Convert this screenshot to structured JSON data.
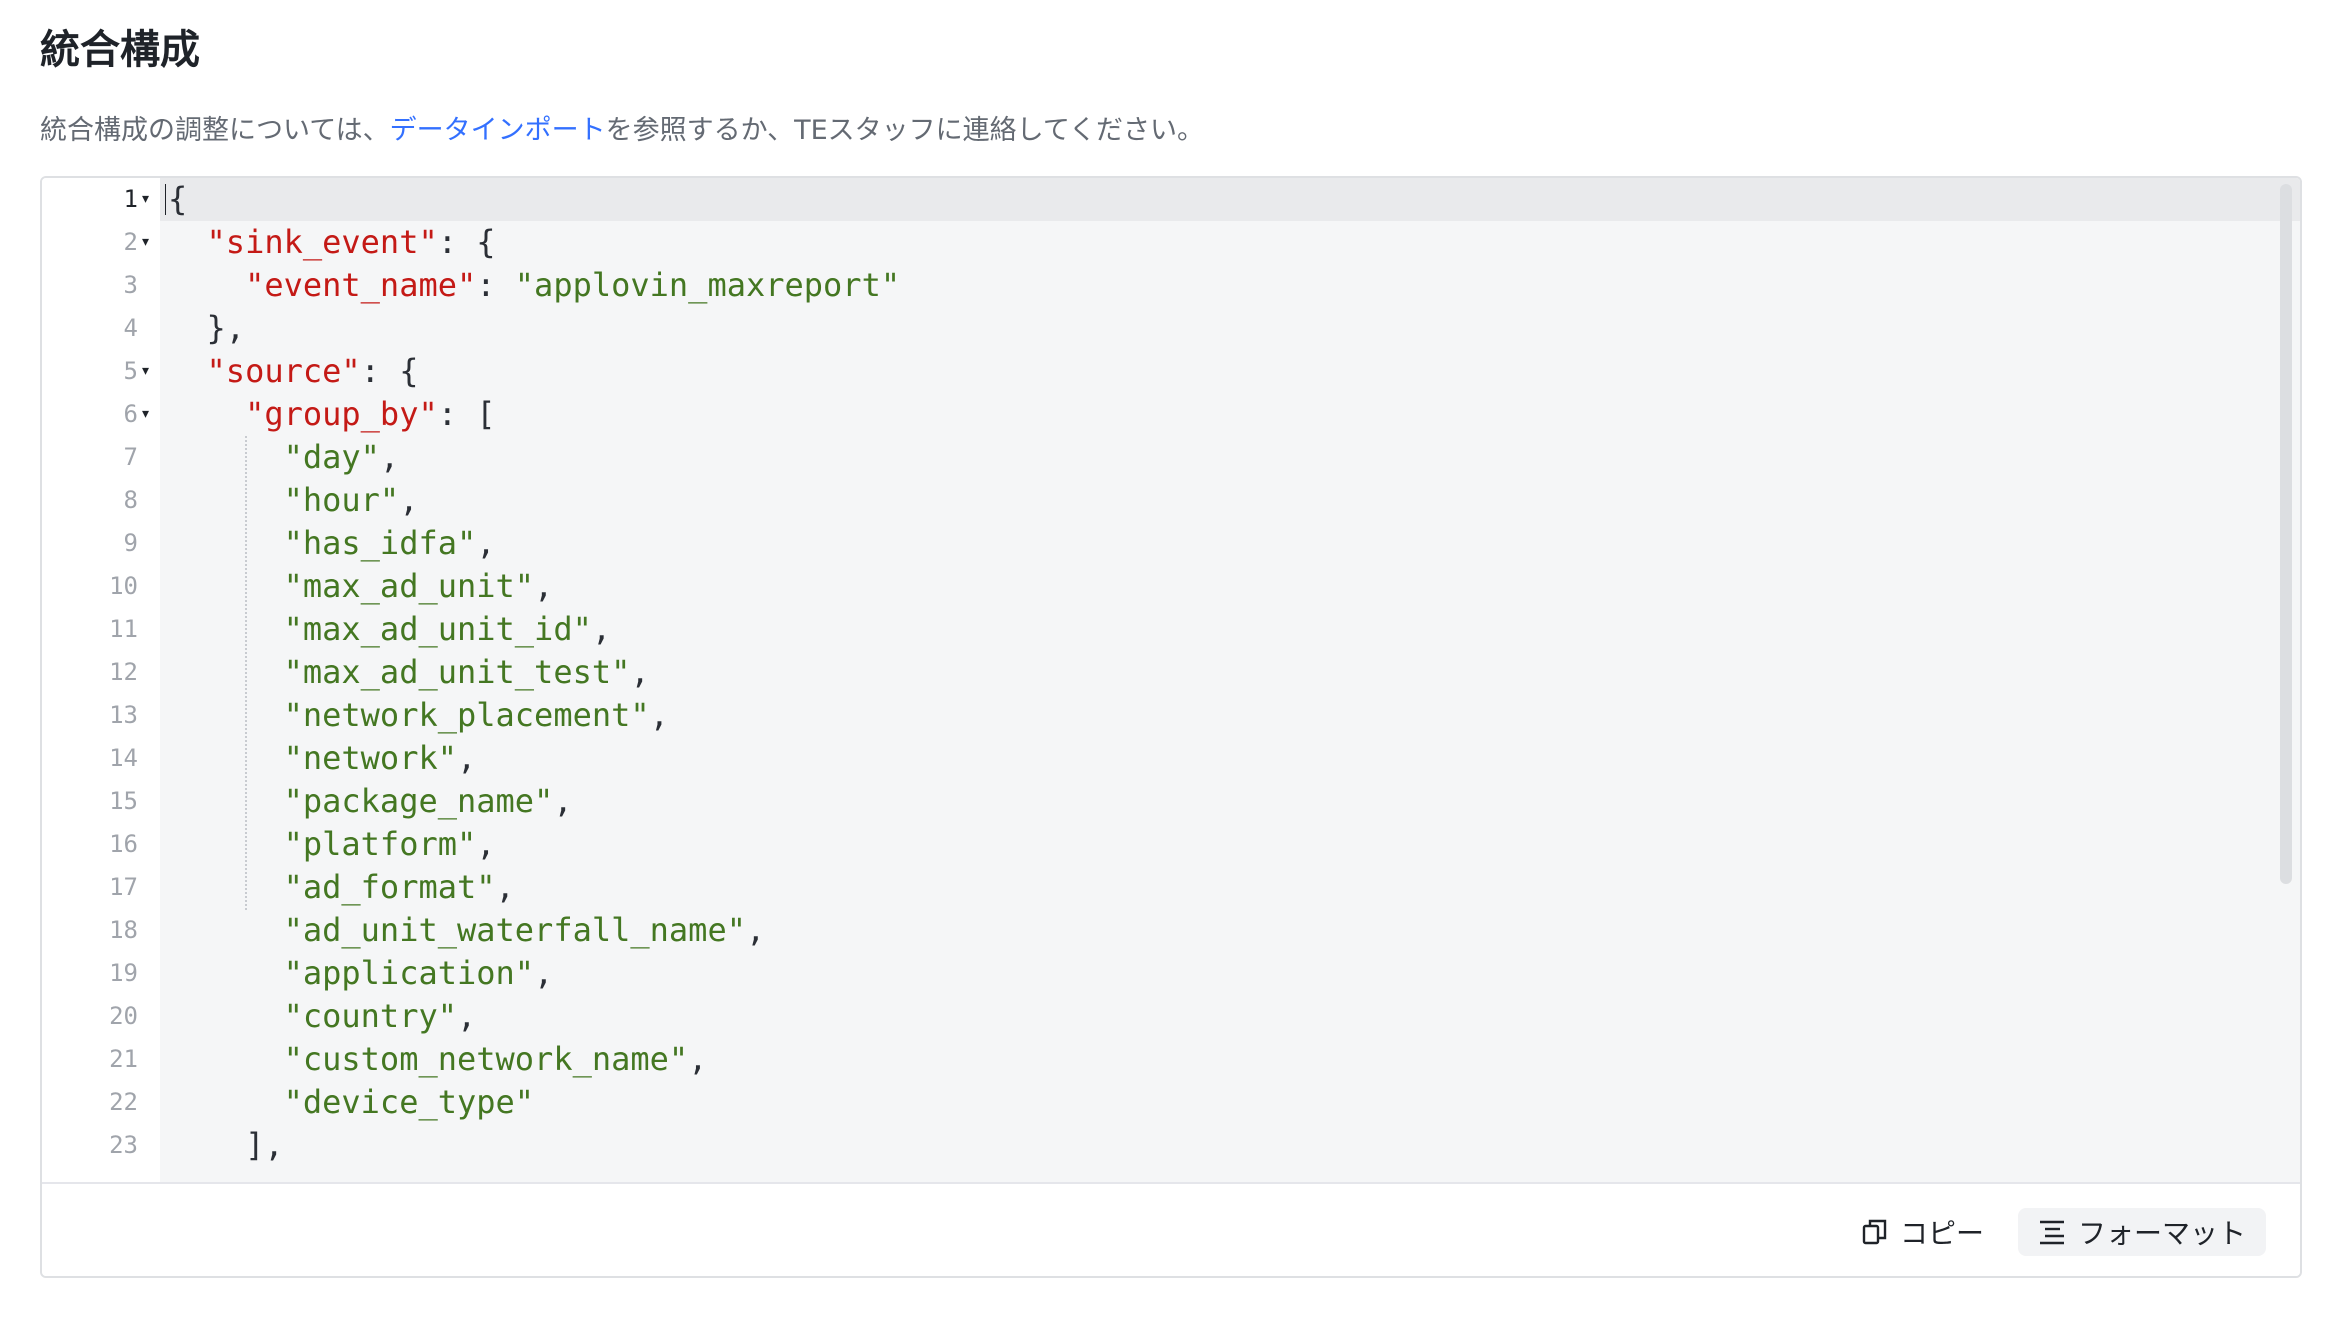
{
  "header": {
    "title": "統合構成",
    "desc_before": "統合構成の調整については、",
    "desc_link": "データインポート",
    "desc_after": "を参照するか、TEスタッフに連絡してください。"
  },
  "editor": {
    "lines": [
      {
        "n": "1",
        "fold": true,
        "indent": 0,
        "tokens": [
          [
            "pun",
            "{"
          ]
        ]
      },
      {
        "n": "2",
        "fold": true,
        "indent": 1,
        "tokens": [
          [
            "key",
            "\"sink_event\""
          ],
          [
            "pun",
            ": {"
          ]
        ]
      },
      {
        "n": "3",
        "fold": false,
        "indent": 2,
        "tokens": [
          [
            "key",
            "\"event_name\""
          ],
          [
            "pun",
            ": "
          ],
          [
            "str",
            "\"applovin_maxreport\""
          ]
        ]
      },
      {
        "n": "4",
        "fold": false,
        "indent": 1,
        "tokens": [
          [
            "pun",
            "},"
          ]
        ]
      },
      {
        "n": "5",
        "fold": true,
        "indent": 1,
        "tokens": [
          [
            "key",
            "\"source\""
          ],
          [
            "pun",
            ": {"
          ]
        ]
      },
      {
        "n": "6",
        "fold": true,
        "indent": 2,
        "tokens": [
          [
            "key",
            "\"group_by\""
          ],
          [
            "pun",
            ": ["
          ]
        ]
      },
      {
        "n": "7",
        "fold": false,
        "indent": 3,
        "tokens": [
          [
            "str",
            "\"day\""
          ],
          [
            "pun",
            ","
          ]
        ]
      },
      {
        "n": "8",
        "fold": false,
        "indent": 3,
        "tokens": [
          [
            "str",
            "\"hour\""
          ],
          [
            "pun",
            ","
          ]
        ]
      },
      {
        "n": "9",
        "fold": false,
        "indent": 3,
        "tokens": [
          [
            "str",
            "\"has_idfa\""
          ],
          [
            "pun",
            ","
          ]
        ]
      },
      {
        "n": "10",
        "fold": false,
        "indent": 3,
        "tokens": [
          [
            "str",
            "\"max_ad_unit\""
          ],
          [
            "pun",
            ","
          ]
        ]
      },
      {
        "n": "11",
        "fold": false,
        "indent": 3,
        "tokens": [
          [
            "str",
            "\"max_ad_unit_id\""
          ],
          [
            "pun",
            ","
          ]
        ]
      },
      {
        "n": "12",
        "fold": false,
        "indent": 3,
        "tokens": [
          [
            "str",
            "\"max_ad_unit_test\""
          ],
          [
            "pun",
            ","
          ]
        ]
      },
      {
        "n": "13",
        "fold": false,
        "indent": 3,
        "tokens": [
          [
            "str",
            "\"network_placement\""
          ],
          [
            "pun",
            ","
          ]
        ]
      },
      {
        "n": "14",
        "fold": false,
        "indent": 3,
        "tokens": [
          [
            "str",
            "\"network\""
          ],
          [
            "pun",
            ","
          ]
        ]
      },
      {
        "n": "15",
        "fold": false,
        "indent": 3,
        "tokens": [
          [
            "str",
            "\"package_name\""
          ],
          [
            "pun",
            ","
          ]
        ]
      },
      {
        "n": "16",
        "fold": false,
        "indent": 3,
        "tokens": [
          [
            "str",
            "\"platform\""
          ],
          [
            "pun",
            ","
          ]
        ]
      },
      {
        "n": "17",
        "fold": false,
        "indent": 3,
        "tokens": [
          [
            "str",
            "\"ad_format\""
          ],
          [
            "pun",
            ","
          ]
        ]
      },
      {
        "n": "18",
        "fold": false,
        "indent": 3,
        "tokens": [
          [
            "str",
            "\"ad_unit_waterfall_name\""
          ],
          [
            "pun",
            ","
          ]
        ]
      },
      {
        "n": "19",
        "fold": false,
        "indent": 3,
        "tokens": [
          [
            "str",
            "\"application\""
          ],
          [
            "pun",
            ","
          ]
        ]
      },
      {
        "n": "20",
        "fold": false,
        "indent": 3,
        "tokens": [
          [
            "str",
            "\"country\""
          ],
          [
            "pun",
            ","
          ]
        ]
      },
      {
        "n": "21",
        "fold": false,
        "indent": 3,
        "tokens": [
          [
            "str",
            "\"custom_network_name\""
          ],
          [
            "pun",
            ","
          ]
        ]
      },
      {
        "n": "22",
        "fold": false,
        "indent": 3,
        "tokens": [
          [
            "str",
            "\"device_type\""
          ]
        ]
      },
      {
        "n": "23",
        "fold": false,
        "indent": 2,
        "tokens": [
          [
            "pun",
            "],"
          ]
        ]
      }
    ]
  },
  "footer": {
    "copy_label": "コピー",
    "copy_icon": "copy-icon",
    "format_label": "フォーマット",
    "format_icon": "align-left-icon"
  }
}
